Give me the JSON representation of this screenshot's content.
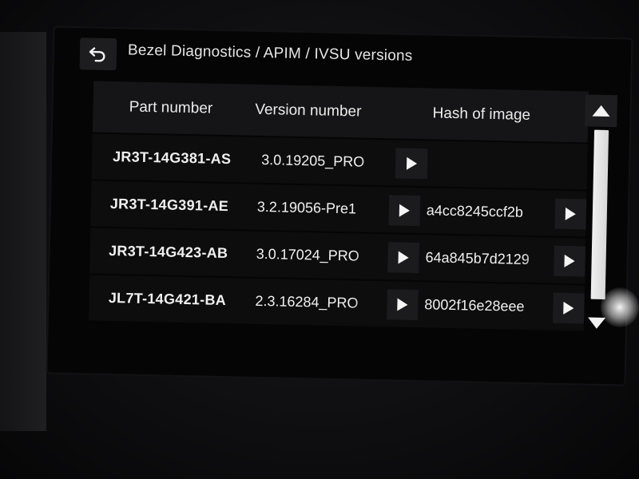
{
  "header": {
    "back_icon": "back-arrow-icon",
    "title": "Bezel Diagnostics / APIM / IVSU versions"
  },
  "table": {
    "columns": [
      "Part number",
      "Version number",
      "Hash of image"
    ],
    "rows": [
      {
        "part": "JR3T-14G381-AS",
        "version": "3.0.19205_PRO",
        "hash": ""
      },
      {
        "part": "JR3T-14G391-AE",
        "version": "3.2.19056-Pre1",
        "hash": "a4cc8245ccf2b"
      },
      {
        "part": "JR3T-14G423-AB",
        "version": "3.0.17024_PRO",
        "hash": "64a845b7d2129"
      },
      {
        "part": "JL7T-14G421-BA",
        "version": "2.3.16284_PRO",
        "hash": "8002f16e28eee"
      }
    ]
  },
  "scrollbar": {
    "up_icon": "triangle-up-icon",
    "down_icon": "triangle-down-icon",
    "position_fraction": 0
  },
  "colors": {
    "text": "#f0f0f0",
    "button_bg": "#1b1b1d",
    "background": "#050505"
  }
}
